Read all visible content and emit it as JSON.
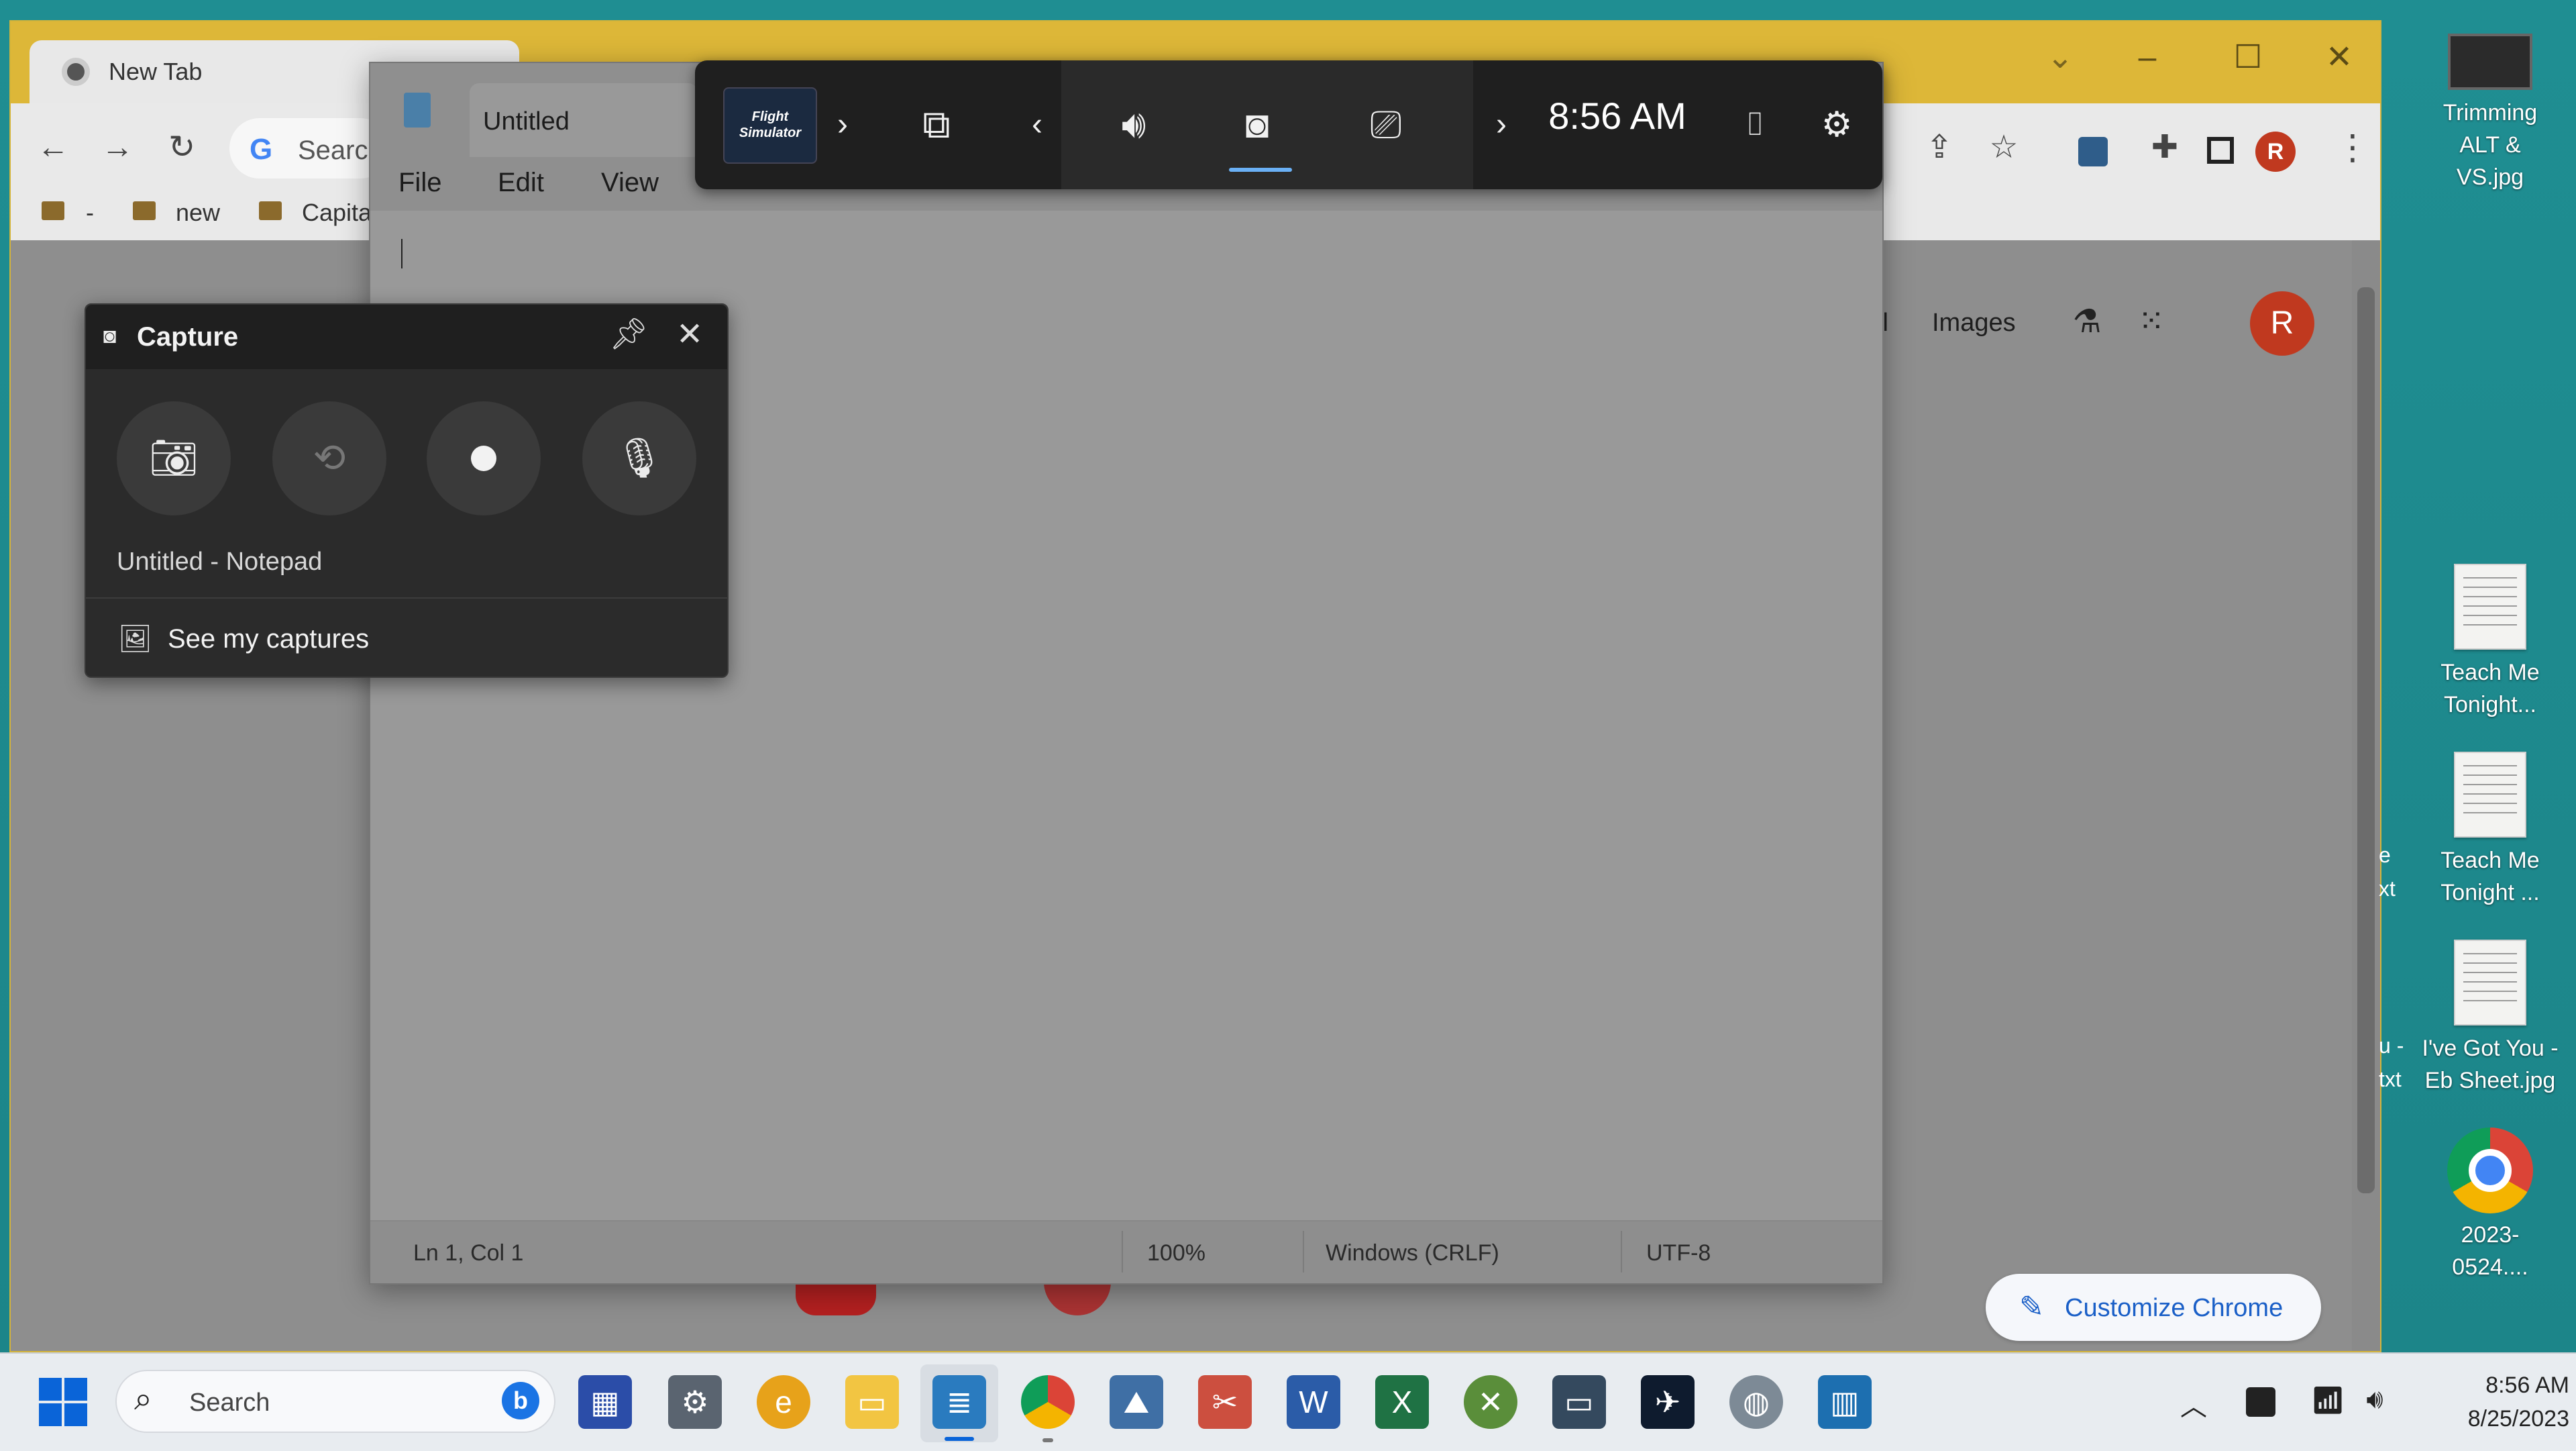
{
  "desktop": {
    "icons": [
      {
        "label": "Trimming ALT & VS.jpg"
      },
      {
        "label": "Teach Me Tonight..."
      },
      {
        "label": "Teach Me Tonight ..."
      },
      {
        "label": "I've Got You - Eb Sheet.jpg"
      },
      {
        "label": "2023-0524...."
      }
    ],
    "peek_labels": [
      "e",
      "xt",
      "u -",
      "txt"
    ]
  },
  "chrome": {
    "tab_title": "New Tab",
    "omnibox_placeholder": "Search",
    "bookmarks": [
      "-",
      "new",
      "Capita"
    ],
    "page_links": [
      "il",
      "Images"
    ],
    "avatar_letter": "R",
    "customize_label": "Customize Chrome",
    "colors": {
      "titlebar": "#ddb738",
      "avatar": "#c0391f"
    }
  },
  "notepad": {
    "tab_title": "Untitled",
    "menu": [
      "File",
      "Edit",
      "View"
    ],
    "status": {
      "position": "Ln 1, Col 1",
      "zoom": "100%",
      "line_endings": "Windows (CRLF)",
      "encoding": "UTF-8"
    }
  },
  "gamebar": {
    "game_thumb_text": "Flight Simulator",
    "time": "8:56 AM",
    "widgets": [
      "performance-icon",
      "audio-icon",
      "capture-icon",
      "resources-icon"
    ]
  },
  "capture_widget": {
    "title": "Capture",
    "target": "Untitled - Notepad",
    "see_captures": "See my captures"
  },
  "taskbar": {
    "search_placeholder": "Search",
    "clock_time": "8:56 AM",
    "clock_date": "8/25/2023"
  }
}
